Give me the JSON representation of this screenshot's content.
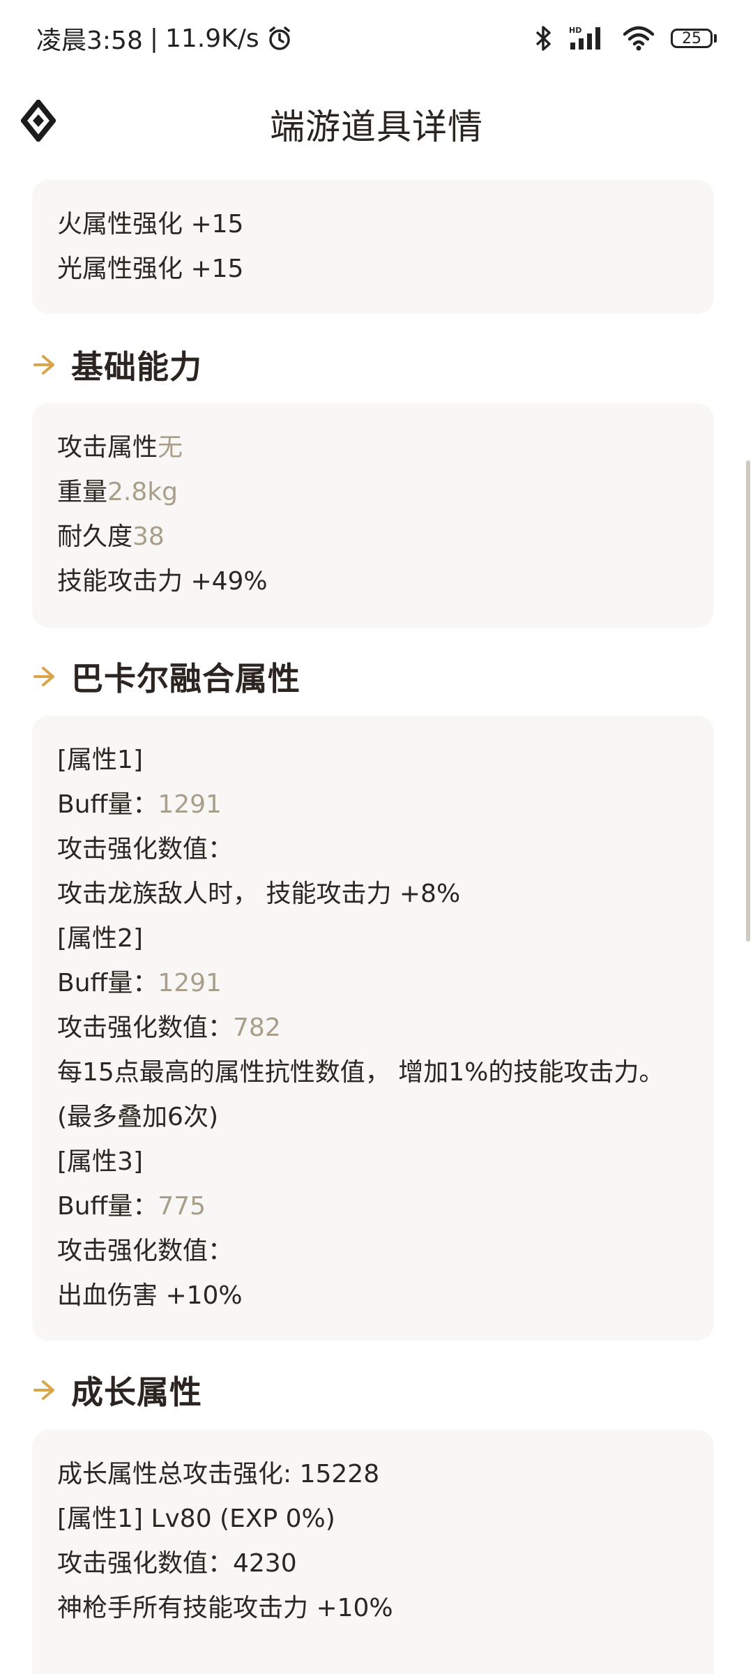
{
  "status": {
    "time": "凌晨3:58",
    "speed": "11.9K/s",
    "battery": "25"
  },
  "header": {
    "title": "端游道具详情"
  },
  "card_elements": {
    "lines": [
      {
        "label": "火属性强化 +15",
        "value": ""
      },
      {
        "label": "光属性强化 +15",
        "value": ""
      }
    ]
  },
  "section_basic": {
    "title": "基础能力"
  },
  "card_basic": {
    "lines": [
      {
        "label": "攻击属性",
        "value": "无"
      },
      {
        "label": "重量",
        "value": "2.8kg"
      },
      {
        "label": "耐久度",
        "value": "38"
      },
      {
        "label": "技能攻击力 +49%",
        "value": ""
      }
    ]
  },
  "section_fusion": {
    "title": "巴卡尔融合属性"
  },
  "card_fusion": {
    "lines": [
      {
        "label": "[属性1]",
        "value": ""
      },
      {
        "label": "Buff量：",
        "value": "1291"
      },
      {
        "label": "攻击强化数值：",
        "value": ""
      },
      {
        "label": "攻击龙族敌人时， 技能攻击力 +8%",
        "value": ""
      },
      {
        "label": "[属性2]",
        "value": ""
      },
      {
        "label": "Buff量：",
        "value": "1291"
      },
      {
        "label": "攻击强化数值：",
        "value": "782"
      },
      {
        "label": "每15点最高的属性抗性数值， 增加1%的技能攻击力。",
        "value": ""
      },
      {
        "label": "(最多叠加6次)",
        "value": ""
      },
      {
        "label": "[属性3]",
        "value": ""
      },
      {
        "label": "Buff量：",
        "value": "775"
      },
      {
        "label": "攻击强化数值：",
        "value": ""
      },
      {
        "label": "出血伤害 +10%",
        "value": ""
      }
    ]
  },
  "section_growth": {
    "title": "成长属性"
  },
  "card_growth": {
    "lines": [
      {
        "label": "成长属性总攻击强化: 15228",
        "value": ""
      },
      {
        "label": "[属性1] Lv80 (EXP 0%)",
        "value": ""
      },
      {
        "label": "攻击强化数值：4230",
        "value": ""
      },
      {
        "label": "神枪手所有技能攻击力 +10%",
        "value": ""
      }
    ]
  },
  "colors": {
    "accent": "#d8a54a",
    "value_text": "#a99e8a",
    "card_bg": "#f8f7f5"
  },
  "icons": {
    "section": "arrow-right-icon",
    "logo": "diamond-logo-icon"
  }
}
